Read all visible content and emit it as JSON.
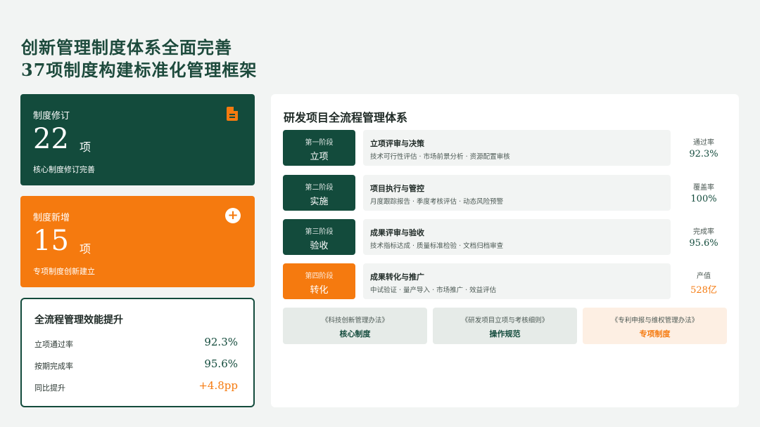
{
  "title": {
    "line1": "创新管理制度体系全面完善",
    "line2": "37项制度构建标准化管理框架"
  },
  "revision_card": {
    "label": "制度修订",
    "value": "22",
    "unit": "项",
    "sub": "核心制度修订完善",
    "icon": "document-icon"
  },
  "new_card": {
    "label": "制度新增",
    "value": "15",
    "unit": "项",
    "sub": "专项制度创新建立",
    "icon": "plus-icon",
    "icon_glyph": "+"
  },
  "efficiency": {
    "title": "全流程管理效能提升",
    "rows": [
      {
        "label": "立项通过率",
        "value": "92.3%"
      },
      {
        "label": "按期完成率",
        "value": "95.6%"
      },
      {
        "label": "同比提升",
        "value": "+4.8pp"
      }
    ]
  },
  "process": {
    "title": "研发项目全流程管理体系",
    "stages": [
      {
        "ordinal": "第一阶段",
        "name": "立项",
        "heading": "立项评审与决策",
        "detail": "技术可行性评估 · 市场前景分析 · 资源配置审核",
        "metric_label": "通过率",
        "metric_value": "92.3%"
      },
      {
        "ordinal": "第二阶段",
        "name": "实施",
        "heading": "项目执行与管控",
        "detail": "月度跟踪报告 · 季度考核评估 · 动态风险预警",
        "metric_label": "覆盖率",
        "metric_value": "100%"
      },
      {
        "ordinal": "第三阶段",
        "name": "验收",
        "heading": "成果评审与验收",
        "detail": "技术指标达成 · 质量标准检验 · 文档归档审查",
        "metric_label": "完成率",
        "metric_value": "95.6%"
      },
      {
        "ordinal": "第四阶段",
        "name": "转化",
        "heading": "成果转化与推广",
        "detail": "中试验证 · 量产导入 · 市场推广 · 效益评估",
        "metric_label": "产值",
        "metric_value": "528亿"
      }
    ],
    "policies": [
      {
        "name": "《科技创新管理办法》",
        "tag": "核心制度"
      },
      {
        "name": "《研发项目立项与考核细则》",
        "tag": "操作规范"
      },
      {
        "name": "《专利申报与维权管理办法》",
        "tag": "专项制度"
      }
    ]
  },
  "colors": {
    "green": "#134b3c",
    "orange": "#f57a0f",
    "orange_light": "#fdefe3",
    "grey_box": "#e6ebe8"
  }
}
